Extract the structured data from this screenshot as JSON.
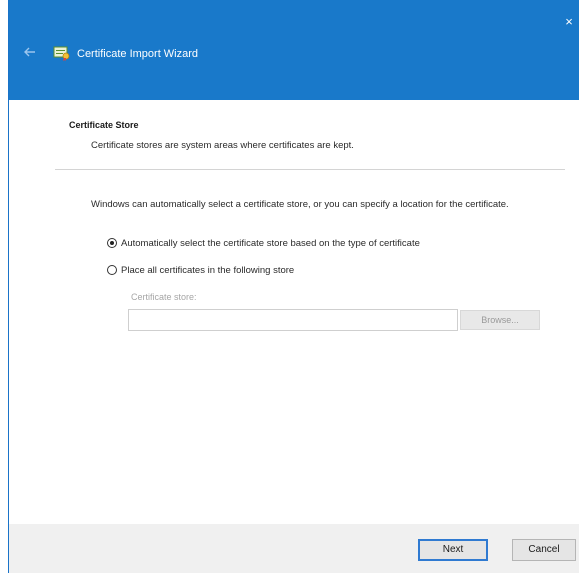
{
  "window": {
    "title": "Certificate Import Wizard",
    "close_glyph": "×"
  },
  "header": {
    "back_icon": "back-arrow-icon",
    "title_icon": "certificate-icon"
  },
  "section": {
    "title": "Certificate Store",
    "subtitle": "Certificate stores are system areas where certificates are kept."
  },
  "main": {
    "intro": "Windows can automatically select a certificate store, or you can specify a location for the certificate.",
    "options": [
      {
        "label": "Automatically select the certificate store based on the type of certificate",
        "checked": true
      },
      {
        "label": "Place all certificates in the following store",
        "checked": false
      }
    ],
    "store_label": "Certificate store:",
    "store_value": "",
    "browse_label": "Browse..."
  },
  "footer": {
    "next_label": "Next",
    "cancel_label": "Cancel"
  },
  "colors": {
    "titlebar": "#1979ca",
    "accent": "#2f7ad1",
    "footer": "#f0f0f0"
  }
}
